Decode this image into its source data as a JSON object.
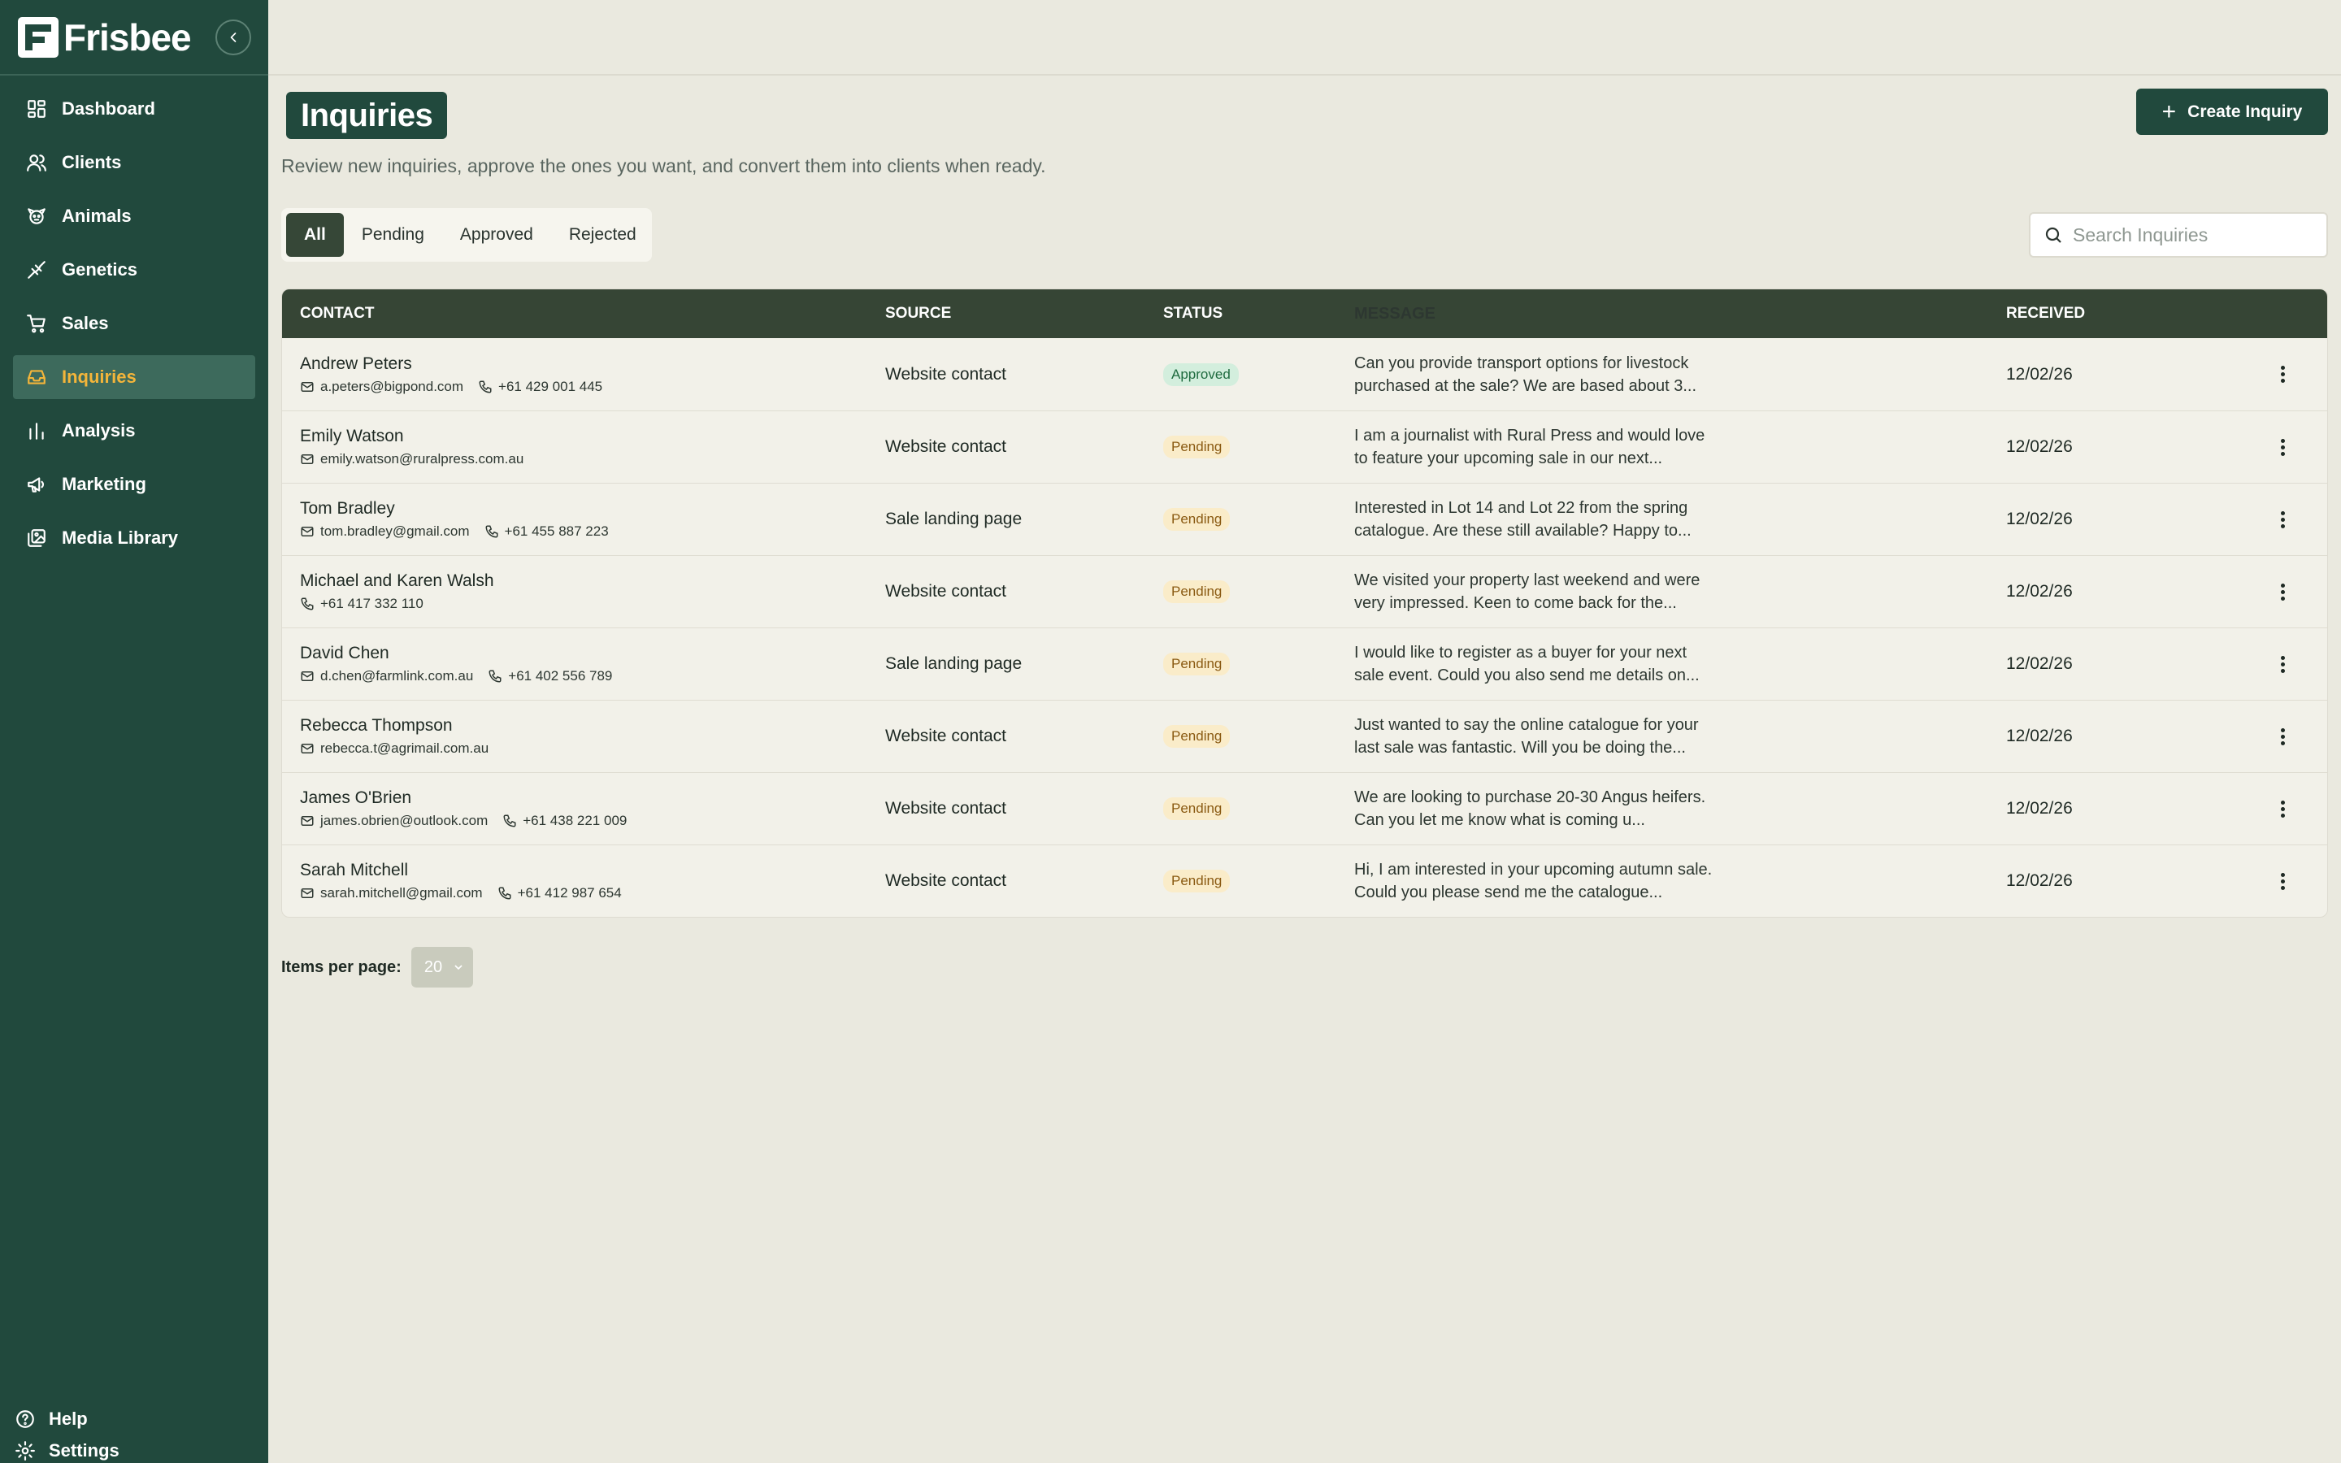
{
  "app": {
    "name": "Frisbee"
  },
  "sidebar": {
    "items": [
      {
        "label": "Dashboard",
        "icon": "dashboard-icon"
      },
      {
        "label": "Clients",
        "icon": "users-icon"
      },
      {
        "label": "Animals",
        "icon": "animal-icon"
      },
      {
        "label": "Genetics",
        "icon": "genetics-icon"
      },
      {
        "label": "Sales",
        "icon": "cart-icon"
      },
      {
        "label": "Inquiries",
        "icon": "inbox-icon",
        "active": true
      },
      {
        "label": "Analysis",
        "icon": "bar-chart-icon"
      },
      {
        "label": "Marketing",
        "icon": "megaphone-icon"
      },
      {
        "label": "Media Library",
        "icon": "media-icon"
      }
    ],
    "bottom": [
      {
        "label": "Help",
        "icon": "help-icon"
      },
      {
        "label": "Settings",
        "icon": "gear-icon"
      }
    ]
  },
  "header": {
    "title": "Inquiries",
    "subtitle": "Review new inquiries, approve the ones you want, and convert them into clients when ready.",
    "create_label": "Create Inquiry"
  },
  "tabs": [
    "All",
    "Pending",
    "Approved",
    "Rejected"
  ],
  "search": {
    "placeholder": "Search Inquiries",
    "value": ""
  },
  "table": {
    "columns": [
      "Contact",
      "Source",
      "Status",
      "Message",
      "Received"
    ],
    "rows": [
      {
        "name": "Andrew Peters",
        "email": "a.peters@bigpond.com",
        "phone": "+61 429 001 445",
        "source": "Website contact",
        "status": "Approved",
        "message": "Can you provide transport options for livestock purchased at the sale? We are based about 3...",
        "received": "12/02/26"
      },
      {
        "name": "Emily Watson",
        "email": "emily.watson@ruralpress.com.au",
        "phone": "",
        "source": "Website contact",
        "status": "Pending",
        "message": "I am a journalist with Rural Press and would love to feature your upcoming sale in our next...",
        "received": "12/02/26"
      },
      {
        "name": "Tom Bradley",
        "email": "tom.bradley@gmail.com",
        "phone": "+61 455 887 223",
        "source": "Sale landing page",
        "status": "Pending",
        "message": "Interested in Lot 14 and Lot 22 from the spring catalogue. Are these still available? Happy to...",
        "received": "12/02/26"
      },
      {
        "name": "Michael and Karen Walsh",
        "email": "",
        "phone": "+61 417 332 110",
        "source": "Website contact",
        "status": "Pending",
        "message": "We visited your property last weekend and were very impressed. Keen to come back for the...",
        "received": "12/02/26"
      },
      {
        "name": "David Chen",
        "email": "d.chen@farmlink.com.au",
        "phone": "+61 402 556 789",
        "source": "Sale landing page",
        "status": "Pending",
        "message": "I would like to register as a buyer for your next sale event. Could you also send me details on...",
        "received": "12/02/26"
      },
      {
        "name": "Rebecca Thompson",
        "email": "rebecca.t@agrimail.com.au",
        "phone": "",
        "source": "Website contact",
        "status": "Pending",
        "message": "Just wanted to say the online catalogue for your last sale was fantastic. Will you be doing the...",
        "received": "12/02/26"
      },
      {
        "name": "James O'Brien",
        "email": "james.obrien@outlook.com",
        "phone": "+61 438 221 009",
        "source": "Website contact",
        "status": "Pending",
        "message": "We are looking to purchase 20-30 Angus heifers. Can you let me know what is coming u...",
        "received": "12/02/26"
      },
      {
        "name": "Sarah Mitchell",
        "email": "sarah.mitchell@gmail.com",
        "phone": "+61 412 987 654",
        "source": "Website contact",
        "status": "Pending",
        "message": "Hi, I am interested in your upcoming autumn sale. Could you please send me the catalogue...",
        "received": "12/02/26"
      }
    ]
  },
  "pagination": {
    "label": "Items per page:",
    "value": "20"
  }
}
